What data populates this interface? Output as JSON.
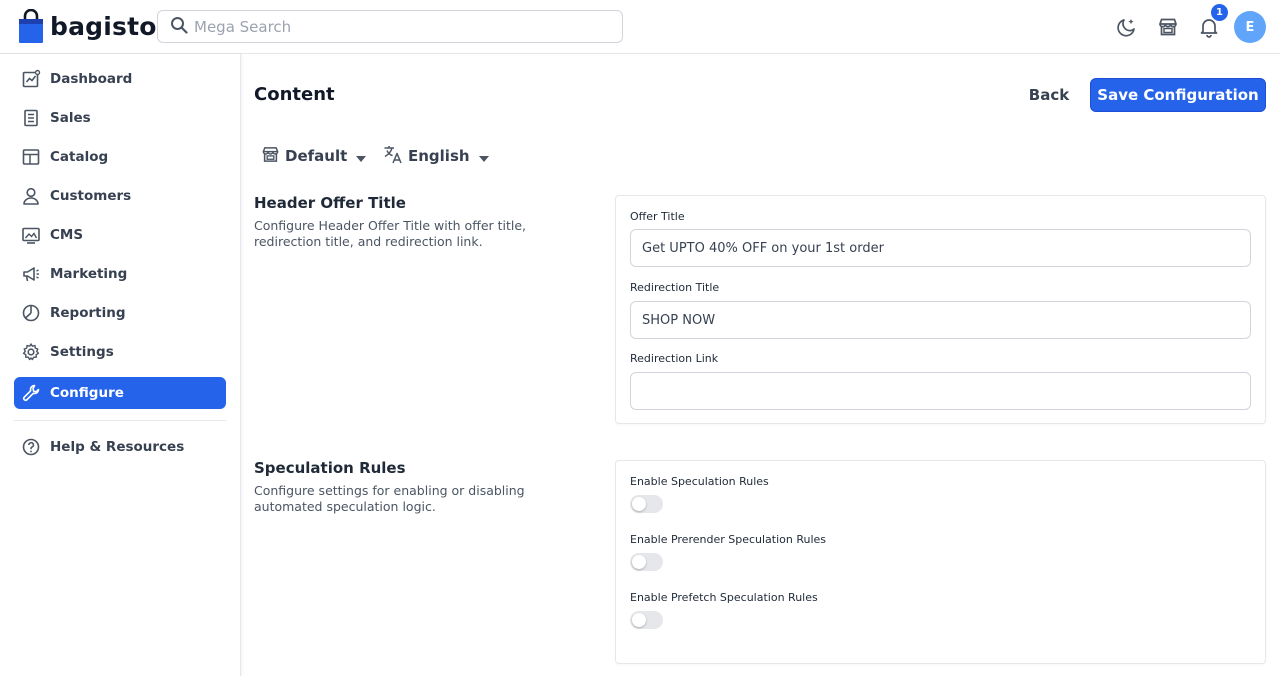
{
  "brand": {
    "name": "bagisto"
  },
  "search": {
    "placeholder": "Mega Search"
  },
  "header": {
    "icons": [
      "dark-mode-icon",
      "storefront-icon",
      "bell-icon"
    ],
    "notification_count": "1",
    "avatar_initial": "E"
  },
  "sidebar": {
    "items": [
      {
        "label": "Dashboard",
        "icon": "dashboard-icon"
      },
      {
        "label": "Sales",
        "icon": "sales-icon"
      },
      {
        "label": "Catalog",
        "icon": "catalog-icon"
      },
      {
        "label": "Customers",
        "icon": "customers-icon"
      },
      {
        "label": "CMS",
        "icon": "cms-icon"
      },
      {
        "label": "Marketing",
        "icon": "marketing-icon"
      },
      {
        "label": "Reporting",
        "icon": "reporting-icon"
      },
      {
        "label": "Settings",
        "icon": "settings-icon"
      },
      {
        "label": "Configure",
        "icon": "configure-icon",
        "active": true
      },
      {
        "label": "Help & Resources",
        "icon": "help-icon"
      }
    ]
  },
  "main": {
    "title": "Content",
    "back_label": "Back",
    "save_label": "Save Configuration",
    "channel": "Default",
    "locale": "English",
    "sections": [
      {
        "title": "Header Offer Title",
        "description": "Configure Header Offer Title with offer title, redirection title, and redirection link.",
        "fields": [
          {
            "label": "Offer Title",
            "value": "Get UPTO 40% OFF on your 1st order"
          },
          {
            "label": "Redirection Title",
            "value": "SHOP NOW"
          },
          {
            "label": "Redirection Link",
            "value": ""
          }
        ]
      },
      {
        "title": "Speculation Rules",
        "description": "Configure settings for enabling or disabling automated speculation logic.",
        "toggles": [
          {
            "label": "Enable Speculation Rules",
            "enabled": false
          },
          {
            "label": "Enable Prerender Speculation Rules",
            "enabled": false
          },
          {
            "label": "Enable Prefetch Speculation Rules",
            "enabled": false
          }
        ]
      }
    ]
  },
  "colors": {
    "accent": "#2563eb",
    "avatar": "#60a5fa",
    "toggle_off": "#e5e7eb"
  }
}
